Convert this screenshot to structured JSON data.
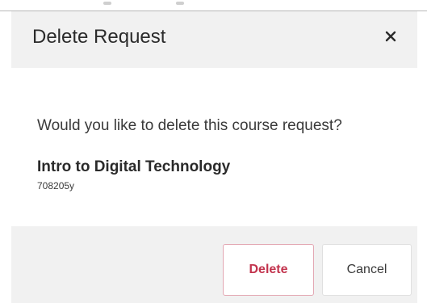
{
  "dialog": {
    "title": "Delete Request",
    "close_icon": "close-icon",
    "prompt": "Would you like to delete this course request?",
    "course": {
      "name": "Intro to Digital Technology",
      "code": "708205y"
    },
    "buttons": {
      "delete_label": "Delete",
      "cancel_label": "Cancel"
    }
  },
  "colors": {
    "header_bg": "#f1f1f1",
    "delete_text": "#c2334d",
    "delete_border": "#e3a7b3"
  }
}
